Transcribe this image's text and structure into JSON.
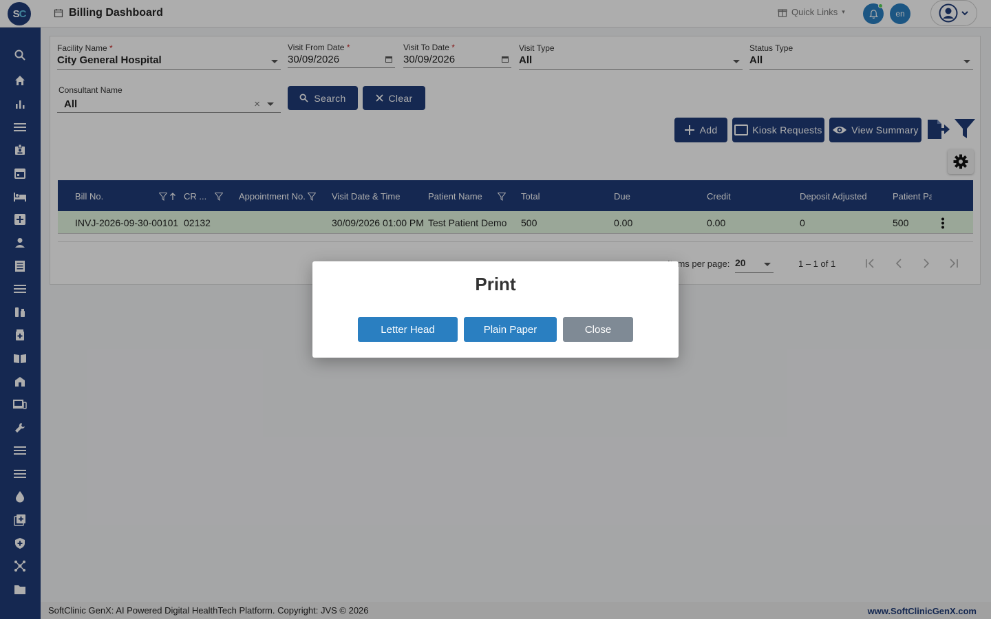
{
  "app": {
    "logo_text_s": "S",
    "logo_text_c": "C",
    "page_title": "Billing Dashboard"
  },
  "header": {
    "quick_links": "Quick Links",
    "lang": "en"
  },
  "filters": {
    "facility": {
      "label": "Facility Name",
      "required": "*",
      "value": "City General Hospital"
    },
    "from_date": {
      "label": "Visit From Date",
      "required": "*",
      "value": "30/09/2026"
    },
    "to_date": {
      "label": "Visit To Date",
      "required": "*",
      "value": "30/09/2026"
    },
    "visit_type": {
      "label": "Visit Type",
      "value": "All"
    },
    "status_type": {
      "label": "Status Type",
      "value": "All"
    },
    "consultant": {
      "label": "Consultant Name",
      "value": "All",
      "clear": "×"
    },
    "search_label": "Search",
    "clear_label": "Clear"
  },
  "toolbar": {
    "add_label": "Add",
    "kiosk_label": "Kiosk Requests",
    "summary_label": "View Summary"
  },
  "table": {
    "columns": [
      "Bill No.",
      "CR ...",
      "Appointment No.",
      "Visit Date & Time",
      "Patient Name",
      "Total",
      "Due",
      "Credit",
      "Deposit Adjusted",
      "Patient Pa"
    ],
    "rows": [
      {
        "bill_no": "INVJ-2026-09-30-00101",
        "cr": "02132",
        "appointment": "",
        "visit_date": "30/09/2026 01:00 PM",
        "patient": "Test Patient Demo",
        "total": "500",
        "due": "0.00",
        "credit": "0.00",
        "deposit": "0",
        "patient_paid": "500"
      }
    ],
    "paginator": {
      "items_label": "Items per page:",
      "page_size": "20",
      "range": "1 – 1 of 1"
    }
  },
  "dialog": {
    "title": "Print",
    "letter_head": "Letter Head",
    "plain_paper": "Plain Paper",
    "close": "Close"
  },
  "footer": {
    "copyright": "SoftClinic GenX: AI Powered Digital HealthTech Platform. Copyright: JVS © 2026",
    "website": "www.SoftClinicGenX.com"
  },
  "colors": {
    "brand": "#1f3b78",
    "accent": "#2a7fc1",
    "row_highlight": "#e3f7e1",
    "close_button": "#7f8a95"
  }
}
